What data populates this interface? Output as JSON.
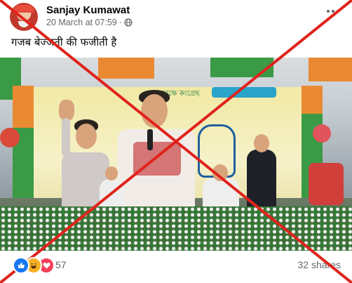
{
  "post": {
    "author": "Sanjay Kumawat",
    "timestamp": "20 March at 07:59",
    "separator": "·",
    "privacy_icon": "globe-icon",
    "caption": "गजब बेज्जती की फजीती है",
    "media_banner_text": "তাক্ষে কংগ্রেছ"
  },
  "footer": {
    "reaction_icons": [
      "like-icon",
      "haha-icon",
      "love-icon"
    ],
    "reaction_count": "57",
    "shares": "32 shares"
  },
  "colors": {
    "facebook_blue": "#1877f2",
    "overlay_red": "#e0231c",
    "secondary_text": "#65676b"
  }
}
